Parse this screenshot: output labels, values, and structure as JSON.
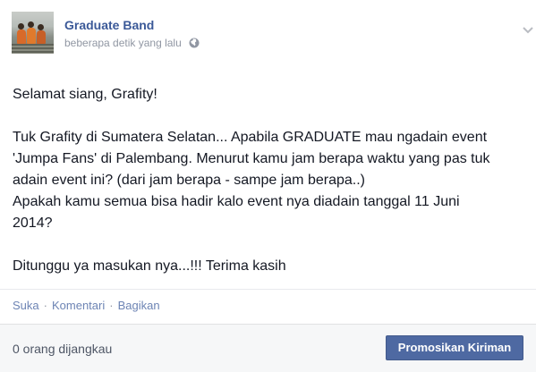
{
  "post": {
    "page_name": "Graduate Band",
    "timestamp": "beberapa detik yang lalu",
    "privacy_icon": "globe-icon",
    "menu_icon": "chevron-down-icon",
    "text_lines": [
      "Selamat siang, Grafity!",
      "",
      "Tuk Grafity di Sumatera Selatan... Apabila GRADUATE mau ngadain event",
      "'Jumpa Fans' di Palembang. Menurut kamu jam berapa waktu yang pas tuk",
      "adain event ini? (dari jam berapa - sampe jam berapa..)",
      "Apakah kamu semua bisa hadir kalo event nya diadain tanggal 11 Juni",
      "2014?",
      "",
      "Ditunggu ya masukan nya...!!! Terima kasih"
    ]
  },
  "actions": {
    "like": "Suka",
    "comment": "Komentari",
    "share": "Bagikan",
    "separator": "·"
  },
  "footer": {
    "reach": "0 orang dijangkau",
    "promote_label": "Promosikan Kiriman"
  },
  "colors": {
    "link": "#3b5998",
    "button": "#4e69a2",
    "muted": "#9197a3"
  }
}
